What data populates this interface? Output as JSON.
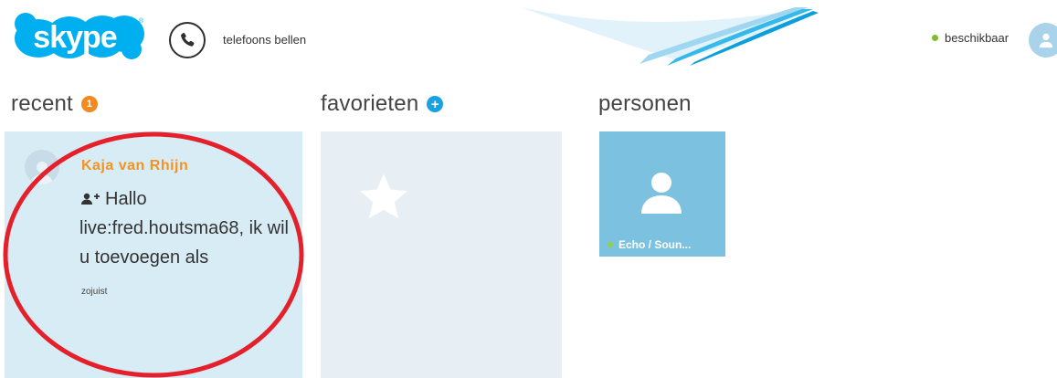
{
  "header": {
    "logo_text": "skype",
    "call_label": "telefoons bellen",
    "status_label": "beschikbaar"
  },
  "columns": {
    "recent": {
      "title": "recent",
      "badge": "1"
    },
    "favorites": {
      "title": "favorieten",
      "badge": "+"
    },
    "people": {
      "title": "personen"
    }
  },
  "recent_item": {
    "name": "Kaja van Rhijn",
    "message": "Hallo live:fred.houtsma68, ik wil u toevoegen als",
    "time": "zojuist"
  },
  "person": {
    "name": "Echo / Soun..."
  },
  "colors": {
    "skype_blue": "#00aff0",
    "accent_orange": "#f39322",
    "status_green": "#7cbd2a",
    "annotation_red": "#e4202b"
  }
}
